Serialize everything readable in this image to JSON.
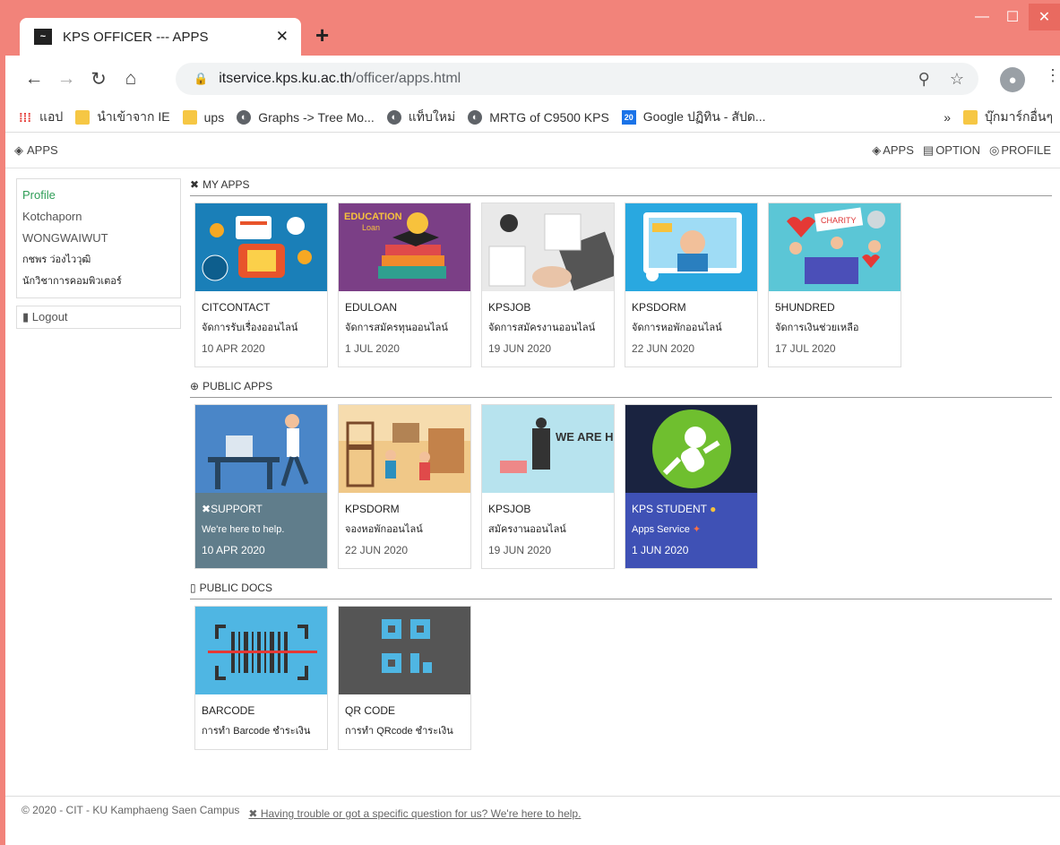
{
  "browser": {
    "tab_title": "KPS OFFICER --- APPS",
    "url_host": "itservice.kps.ku.ac.th",
    "url_path": "/officer/apps.html",
    "bookmarks": [
      {
        "label": "แอป",
        "icon": "apps-grid-icon"
      },
      {
        "label": "นำเข้าจาก IE",
        "icon": "folder-icon"
      },
      {
        "label": "ups",
        "icon": "folder-icon"
      },
      {
        "label": "Graphs -> Tree Mo...",
        "icon": "globe-icon"
      },
      {
        "label": "แท็บใหม่",
        "icon": "globe-icon"
      },
      {
        "label": "MRTG of C9500 KPS",
        "icon": "globe-icon"
      },
      {
        "label": "Google ปฏิทิน - สัปด...",
        "icon": "calendar-icon"
      }
    ],
    "more": "»",
    "other_bookmarks": "บุ๊กมาร์กอื่นๆ"
  },
  "appbar": {
    "brand": "APPS",
    "nav": [
      "APPS",
      "OPTION",
      "PROFILE"
    ]
  },
  "sidebar": {
    "profile_link": "Profile",
    "first_name": "Kotchaporn",
    "last_name": "WONGWAIWUT",
    "thai_name": "กชพร ว่องไววุฒิ",
    "position": "นักวิชาการคอมพิวเตอร์",
    "logout": "Logout"
  },
  "sections": {
    "my_apps": "MY APPS",
    "public_apps": "PUBLIC APPS",
    "public_docs": "PUBLIC DOCS"
  },
  "my_apps": [
    {
      "title": "CITCONTACT",
      "desc": "จัดการรับเรื่องออนไลน์",
      "date": "10 APR 2020"
    },
    {
      "title": "EDULOAN",
      "desc": "จัดการสมัครทุนออนไลน์",
      "date": "1 JUL 2020"
    },
    {
      "title": "KPSJOB",
      "desc": "จัดการสมัครงานออนไลน์",
      "date": "19 JUN 2020"
    },
    {
      "title": "KPSDORM",
      "desc": "จัดการหอพักออนไลน์",
      "date": "22 JUN 2020"
    },
    {
      "title": "5HUNDRED",
      "desc": "จัดการเงินช่วยเหลือ",
      "date": "17 JUL 2020"
    }
  ],
  "public_apps": [
    {
      "title": "SUPPORT",
      "desc": "We're here to help.",
      "date": "10 APR 2020"
    },
    {
      "title": "KPSDORM",
      "desc": "จองหอพักออนไลน์",
      "date": "22 JUN 2020"
    },
    {
      "title": "KPSJOB",
      "desc": "สมัครงานออนไลน์",
      "date": "19 JUN 2020"
    },
    {
      "title": "KPS STUDENT",
      "desc": "Apps Service",
      "date": "1 JUN 2020"
    }
  ],
  "public_docs": [
    {
      "title": "BARCODE",
      "desc": "การทำ Barcode ชำระเงิน"
    },
    {
      "title": "QR CODE",
      "desc": "การทำ QRcode ชำระเงิน"
    }
  ],
  "images": {
    "eduloan_line1": "EDUCATION",
    "eduloan_line2": "Loan",
    "charity": "CHARITY",
    "hiring": "WE ARE HIRING!"
  },
  "footer": {
    "copyright": "© 2020 - CIT - KU Kamphaeng Saen Campus",
    "help": "Having trouble or got a specific question for us? We're here to help."
  }
}
